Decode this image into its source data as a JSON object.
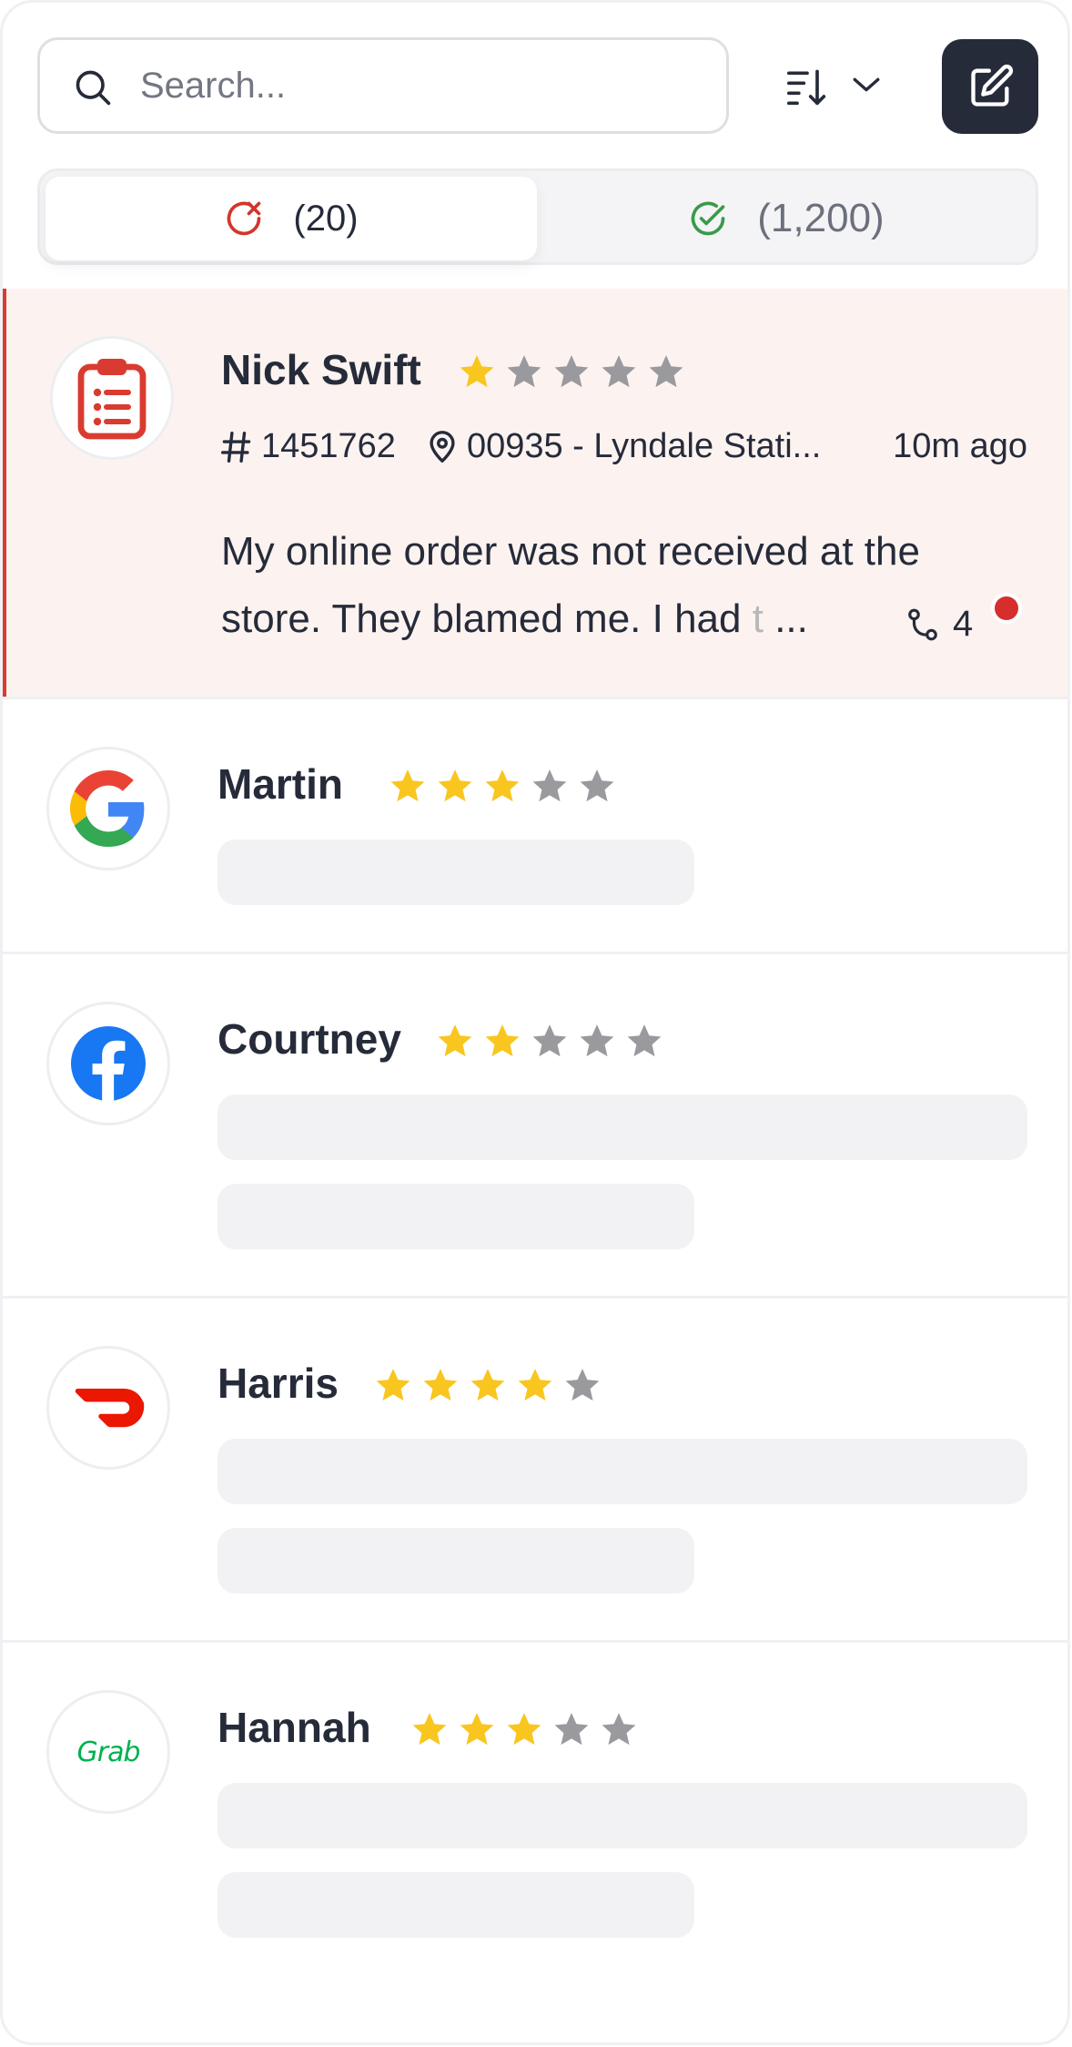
{
  "search": {
    "placeholder": "Search..."
  },
  "sort": {
    "icon": "sort-descending-icon",
    "chevron": "chevron-down-icon"
  },
  "compose": {
    "icon": "edit-icon"
  },
  "tabs": [
    {
      "label": "(20)",
      "icon": "x-circle-icon",
      "color": "#d5342b",
      "active": true
    },
    {
      "label": "(1,200)",
      "icon": "check-circle-icon",
      "color": "#3a9a4a",
      "active": false
    }
  ],
  "reviews": [
    {
      "name": "Nick Swift",
      "source_icon": "clipboard-icon",
      "rating": 1,
      "id": "1451762",
      "location": "00935 - Lyndale Stati...",
      "time": "10m ago",
      "message_line1": "My online order was not received at the",
      "message_line2": "store. They blamed me. I had t",
      "message_fade": "t",
      "message_ellipsis": "...",
      "replies": "4",
      "unread": true
    },
    {
      "name": "Martin",
      "source_icon": "google-icon",
      "rating": 3
    },
    {
      "name": "Courtney",
      "source_icon": "facebook-icon",
      "rating": 2
    },
    {
      "name": "Harris",
      "source_icon": "doordash-icon",
      "rating": 4
    },
    {
      "name": "Hannah",
      "source_icon": "grab-icon",
      "rating": 3
    }
  ],
  "colors": {
    "star_filled": "#f8c61f",
    "star_empty": "#9a9a9e",
    "highlight_bg": "#fcf3f0",
    "accent_red": "#d93b30",
    "dark": "#262b3a"
  },
  "logos": {
    "grab": "Grab"
  }
}
